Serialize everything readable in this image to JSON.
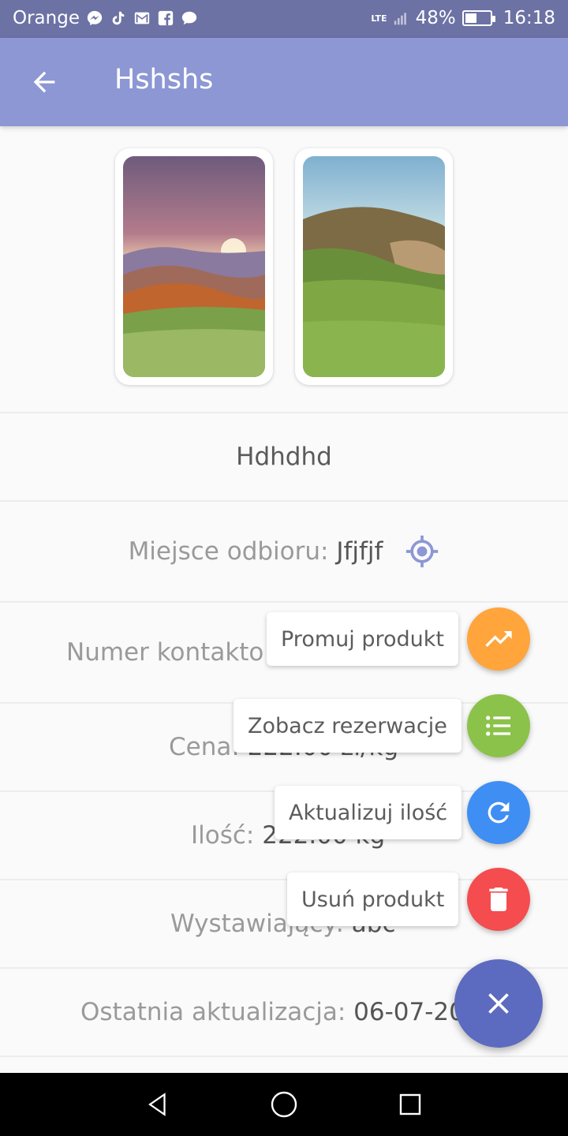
{
  "status_bar": {
    "carrier": "Orange",
    "network": "LTE",
    "battery_percent_label": "48%",
    "battery_level": 0.48,
    "time": "16:18",
    "notification_icons": [
      "messenger-icon",
      "tiktok-icon",
      "gmail-icon",
      "facebook-icon",
      "message-bubble-icon"
    ]
  },
  "app_bar": {
    "title": "Hshshs",
    "back_icon": "arrow-left-icon"
  },
  "product": {
    "name": "Hdhdhd",
    "place_label": "Miejsce odbioru:",
    "place_value": "Jfjfjf",
    "phone_label": "Numer kontakto",
    "price_label": "Cena:",
    "price_value": "222.00 zł/kg",
    "quantity_label": "Ilość:",
    "quantity_value": "222.00 kg",
    "seller_label": "Wystawiający:",
    "seller_value": "abc",
    "updated_label": "Ostatnia aktualizacja:",
    "updated_value": "06-07-20"
  },
  "fab_menu": {
    "items": [
      {
        "label": "Promuj produkt",
        "icon": "trending-up-icon",
        "color": "#ffa53c"
      },
      {
        "label": "Zobacz rezerwacje",
        "icon": "list-icon",
        "color": "#8bc24a"
      },
      {
        "label": "Aktualizuj ilość",
        "icon": "refresh-icon",
        "color": "#3f8ef3"
      },
      {
        "label": "Usuń produkt",
        "icon": "trash-icon",
        "color": "#f44c4f"
      }
    ],
    "main_icon": "close-icon",
    "main_color": "#5c6bc0"
  },
  "colors": {
    "status_bar": "#6c72a4",
    "app_bar": "#8c97d4",
    "accent": "#8c97d4"
  }
}
